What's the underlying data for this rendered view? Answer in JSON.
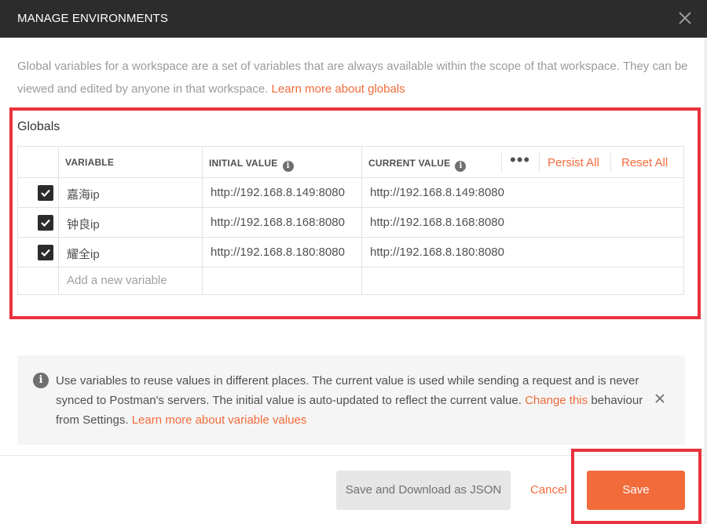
{
  "modal": {
    "title": "MANAGE ENVIRONMENTS",
    "description_text": "Global variables for a workspace are a set of variables that are always available within the scope of that workspace. They can be viewed and edited by anyone in that workspace.",
    "learn_more_globals": "Learn more about globals"
  },
  "globals": {
    "heading": "Globals",
    "columns": {
      "variable": "VARIABLE",
      "initial_value": "INITIAL VALUE",
      "current_value": "CURRENT VALUE"
    },
    "more_actions": "•••",
    "persist_all": "Persist All",
    "reset_all": "Reset All",
    "rows": [
      {
        "checked": true,
        "variable": "嘉海ip",
        "initial_value": "http://192.168.8.149:8080",
        "current_value": "http://192.168.8.149:8080"
      },
      {
        "checked": true,
        "variable": "钟良ip",
        "initial_value": "http://192.168.8.168:8080",
        "current_value": "http://192.168.8.168:8080"
      },
      {
        "checked": true,
        "variable": "耀全ip",
        "initial_value": "http://192.168.8.180:8080",
        "current_value": "http://192.168.8.180:8080"
      }
    ],
    "new_variable_placeholder": "Add a new variable"
  },
  "tip": {
    "text": "Use variables to reuse values in different places. The current value is used while sending a request and is never synced to Postman's servers. The initial value is auto-updated to reflect the current value.",
    "change_link": "Change this",
    "text_after_link": "behaviour from Settings.",
    "learn_more_link": "Learn more about variable values"
  },
  "footer": {
    "save_download_label": "Save and Download as JSON",
    "cancel_label": "Cancel",
    "save_label": "Save"
  },
  "colors": {
    "accent": "#f26b3a",
    "titlebar": "#2c2c2c",
    "highlight_box": "#e8323c"
  },
  "icons": [
    "close-icon",
    "info-icon",
    "checkbox-checked-icon",
    "more-horizontal-icon"
  ]
}
